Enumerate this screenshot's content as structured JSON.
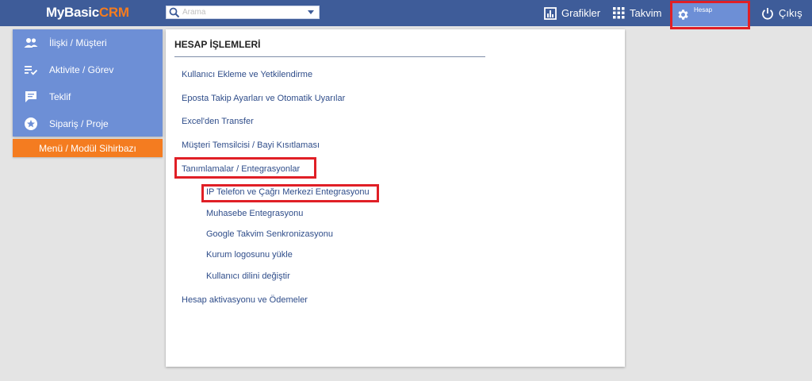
{
  "app": {
    "logo_main": "MyBasic",
    "logo_accent": "CRM"
  },
  "search": {
    "placeholder": "Arama"
  },
  "topnav": {
    "charts_label": "Grafikler",
    "calendar_label": "Takvim",
    "account_label": "Hesap",
    "logout_label": "Çıkış"
  },
  "sidebar": {
    "items": [
      {
        "label": "İlişki / Müşteri",
        "icon": "people-icon"
      },
      {
        "label": "Aktivite / Görev",
        "icon": "checklist-icon"
      },
      {
        "label": "Teklif",
        "icon": "message-icon"
      },
      {
        "label": "Sipariş / Proje",
        "icon": "star-icon"
      }
    ],
    "wizard_label": "Menü / Modül Sihirbazı"
  },
  "panel": {
    "title": "HESAP İŞLEMLERİ",
    "links": [
      "Kullanıcı Ekleme ve Yetkilendirme",
      "Eposta Takip Ayarları ve Otomatik Uyarılar",
      "Excel'den Transfer",
      "Müşteri Temsilcisi / Bayi Kısıtlaması",
      "Tanımlamalar / Entegrasyonlar"
    ],
    "sublinks": [
      "IP Telefon ve Çağrı Merkezi Entegrasyonu",
      "Muhasebe Entegrasyonu",
      "Google Takvim Senkronizasyonu",
      "Kurum logosunu yükle",
      "Kullanıcı dilini değiştir"
    ],
    "footer_link": "Hesap aktivasyonu ve Ödemeler"
  },
  "colors": {
    "topbar": "#3e5c99",
    "sidebar": "#6d8fd6",
    "accent": "#f47c20",
    "highlight": "#e01f26",
    "link": "#2f4d8a"
  }
}
